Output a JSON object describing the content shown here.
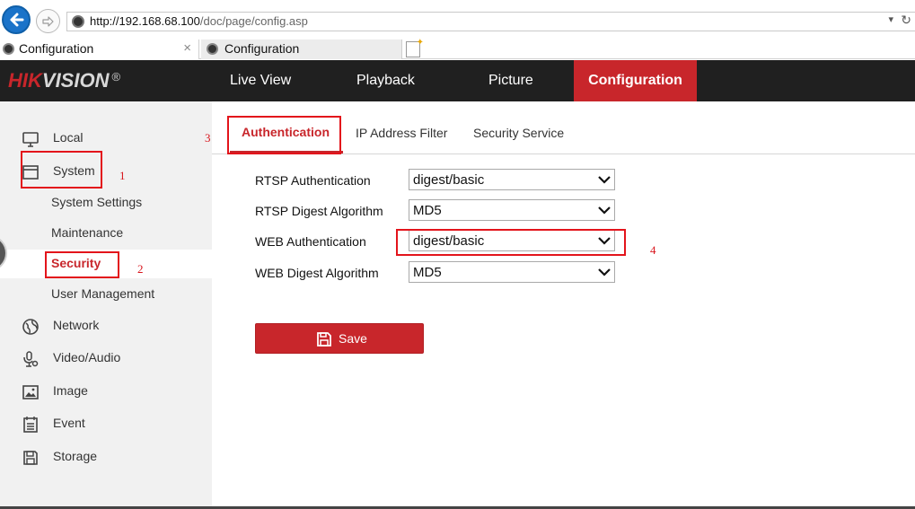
{
  "browser": {
    "url_host": "http://192.168.68.100",
    "url_path": "/doc/page/config.asp",
    "tabs": [
      {
        "title": "Configuration",
        "close": "×"
      },
      {
        "title": "Configuration"
      }
    ]
  },
  "header": {
    "logo_red": "HIK",
    "logo_grey": "VISION",
    "logo_mark": "®",
    "nav": [
      {
        "label": "Live View",
        "active": false
      },
      {
        "label": "Playback",
        "active": false
      },
      {
        "label": "Picture",
        "active": false
      },
      {
        "label": "Configuration",
        "active": true
      }
    ]
  },
  "sidebar": {
    "items": [
      {
        "label": "Local",
        "icon": "monitor-icon"
      },
      {
        "label": "System",
        "icon": "window-icon"
      },
      {
        "label": "Network",
        "icon": "globe-icon"
      },
      {
        "label": "Video/Audio",
        "icon": "microphone-icon"
      },
      {
        "label": "Image",
        "icon": "image-icon"
      },
      {
        "label": "Event",
        "icon": "calendar-icon"
      },
      {
        "label": "Storage",
        "icon": "disk-icon"
      }
    ],
    "system_subitems": [
      {
        "label": "System Settings",
        "active": false
      },
      {
        "label": "Maintenance",
        "active": false
      },
      {
        "label": "Security",
        "active": true
      },
      {
        "label": "User Management",
        "active": false
      }
    ]
  },
  "content": {
    "tabs": [
      {
        "label": "Authentication",
        "active": true
      },
      {
        "label": "IP Address Filter",
        "active": false
      },
      {
        "label": "Security Service",
        "active": false
      }
    ],
    "fields": [
      {
        "label": "RTSP Authentication",
        "value": "digest/basic"
      },
      {
        "label": "RTSP Digest Algorithm",
        "value": "MD5"
      },
      {
        "label": "WEB Authentication",
        "value": "digest/basic"
      },
      {
        "label": "WEB Digest Algorithm",
        "value": "MD5"
      }
    ],
    "save_label": "Save"
  },
  "annotations": {
    "marks": [
      "1",
      "2",
      "3",
      "4"
    ],
    "highlight_color": "#e3141b"
  },
  "colors": {
    "accent": "#c8262b",
    "header_bg": "#202020",
    "sidebar_bg": "#f1f1f1"
  }
}
